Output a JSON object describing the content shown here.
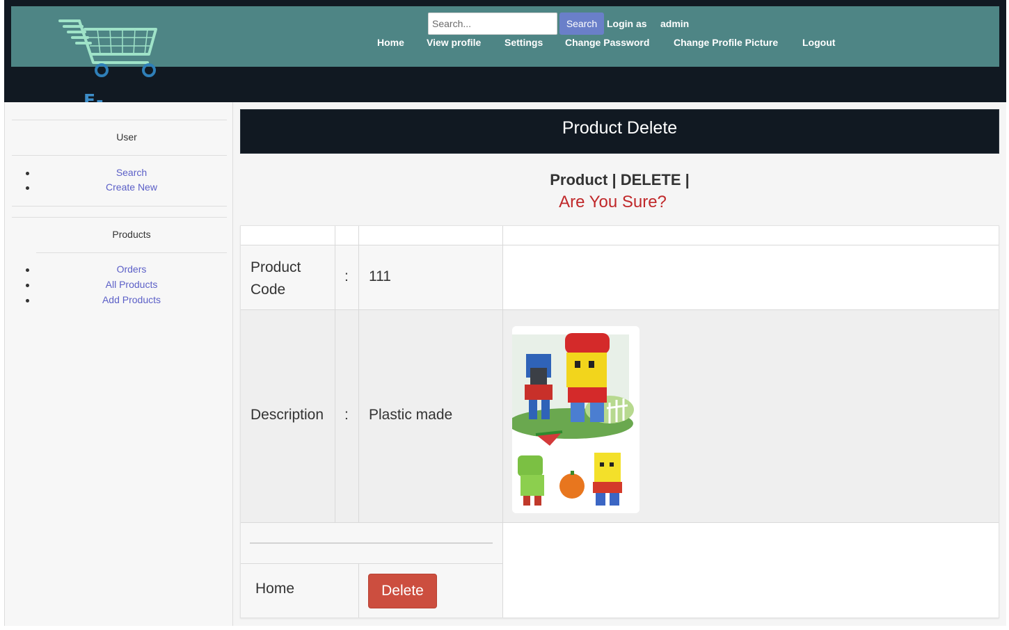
{
  "header": {
    "logo_text": "E-SHOP",
    "search_placeholder": "Search...",
    "search_button": "Search",
    "login_label": "Login as",
    "login_user": "admin",
    "nav": [
      {
        "label": "Home"
      },
      {
        "label": "View profile"
      },
      {
        "label": "Settings"
      },
      {
        "label": "Change Password"
      },
      {
        "label": "Change Profile Picture"
      },
      {
        "label": "Logout"
      }
    ],
    "colors": {
      "topbar": "#4e8585",
      "header_dark": "#111922",
      "search_button": "#6a7fc9"
    }
  },
  "sidebar": {
    "sections": [
      {
        "heading": "User",
        "items": [
          {
            "label": "Search"
          },
          {
            "label": "Create New"
          }
        ]
      },
      {
        "heading": "Products",
        "items": [
          {
            "label": "Orders"
          },
          {
            "label": "All Products"
          },
          {
            "label": "Add Products"
          }
        ]
      }
    ]
  },
  "main": {
    "title": "Product Delete",
    "confirm_heading": "Product | DELETE |",
    "confirm_question": "Are You Sure?",
    "rows": [
      {
        "label": "Product Code",
        "separator": ":",
        "value": "111"
      },
      {
        "label": "Description",
        "separator": ":",
        "value": "Plastic made"
      }
    ],
    "home_link": "Home",
    "delete_button": "Delete",
    "colors": {
      "confirm_question": "#c0282a",
      "delete_button": "#cc4e3f"
    }
  }
}
